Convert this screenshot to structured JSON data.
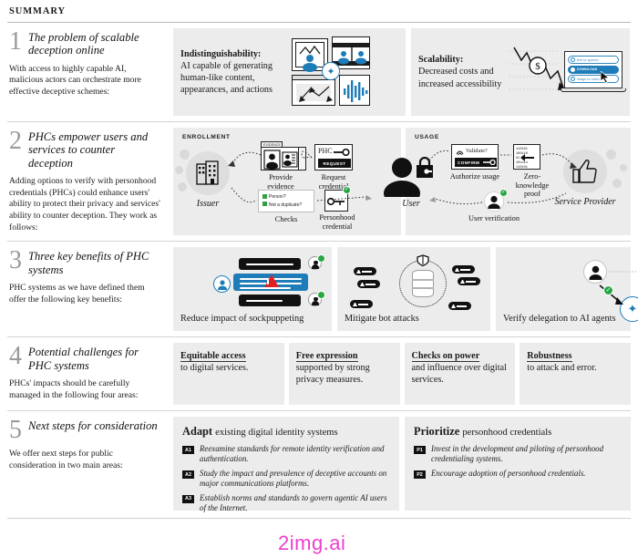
{
  "header": {
    "title": "SUMMARY"
  },
  "accent": {
    "blue": "#1e7cb8",
    "green": "#27a744",
    "red": "#e02020",
    "card": "#ececec",
    "watermark": "#ec3fd0"
  },
  "watermark": {
    "text": "2img.ai"
  },
  "sections": [
    {
      "number": "1",
      "title": "The problem of scalable deception online",
      "blurb": "With access to highly capable AI, malicious actors can orchestrate more effective deceptive schemes:",
      "cards": [
        {
          "heading": "Indistinguishability:",
          "body": "AI capable of generating human-like content, appearances, and actions"
        },
        {
          "heading": "Scalability:",
          "body": "Decreased costs and increased accessibility"
        }
      ],
      "laptop_options": [
        "text to speech",
        "DOWNLOAD",
        "image to video"
      ],
      "money_symbol": "$"
    },
    {
      "number": "2",
      "title": "PHCs empower users and services to counter deception",
      "blurb": "Adding options to verify with personhood credentials (PHCs) could enhance users' ability to protect their privacy and services' ability to counter deception. They work as follows:",
      "enrollment": {
        "section_label": "ENROLLMENT",
        "issuer": "Issuer",
        "evidence_tab": "EVIDENCE",
        "provide_evidence": "Provide evidence",
        "phc_label": "PHC",
        "request_button": "REQUEST",
        "request_credential": "Request credential",
        "checks_label": "Checks",
        "checks": [
          "Person?",
          "Not a duplicate?"
        ],
        "personhood_credential": "Personhood credential"
      },
      "usage": {
        "section_label": "USAGE",
        "user": "User",
        "validate_label": "Validate?",
        "confirm_button": "CONFIRM",
        "authorize_usage": "Authorize usage",
        "zero_knowledge_proof": "Zero-knowledge proof",
        "service_provider": "Service Provider",
        "user_verification": "User verification"
      }
    },
    {
      "number": "3",
      "title": "Three key benefits of PHC systems",
      "blurb": "PHC systems as we have defined them offer the following key benefits:",
      "benefits": [
        "Reduce impact of sockpuppeting",
        "Mitigate bot attacks",
        "Verify delegation to AI agents"
      ]
    },
    {
      "number": "4",
      "title": "Potential challenges for PHC systems",
      "blurb": "PHCs' impacts should be carefully managed in the following four areas:",
      "challenges": [
        {
          "heading": "Equitable access",
          "body": "to digital services."
        },
        {
          "heading": "Free expression",
          "body": "supported by strong privacy measures."
        },
        {
          "heading": "Checks on power",
          "body": "and influence over digital services."
        },
        {
          "heading": "Robustness",
          "body": "to attack and error."
        }
      ]
    },
    {
      "number": "5",
      "title": "Next steps for consideration",
      "blurb": "We offer next steps for public consideration in two main areas:",
      "columns": [
        {
          "heading_bold": "Adapt",
          "heading_rest": "existing digital identity systems",
          "items": [
            {
              "tag": "A1",
              "text": "Reexamine standards for remote identity verification and authentication."
            },
            {
              "tag": "A2",
              "text": "Study the impact and prevalence of deceptive accounts on major communications platforms."
            },
            {
              "tag": "A3",
              "text": "Establish norms and standards to govern agentic AI users of the Internet."
            }
          ]
        },
        {
          "heading_bold": "Prioritize",
          "heading_rest": "personhood credentials",
          "items": [
            {
              "tag": "P1",
              "text": "Invest in the development and piloting of personhood credentialing systems."
            },
            {
              "tag": "P2",
              "text": "Encourage adoption of personhood credentials."
            }
          ]
        }
      ]
    }
  ]
}
